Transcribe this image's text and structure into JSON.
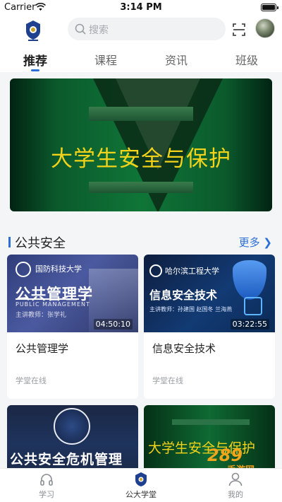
{
  "status_bar": {
    "carrier": "Carrier",
    "time": "3:14 PM"
  },
  "header": {
    "search_placeholder": "搜索",
    "logo_icon": "campus-emblem-icon",
    "scan_icon": "scan-icon"
  },
  "tabs": [
    {
      "label": "推荐",
      "active": true
    },
    {
      "label": "课程",
      "active": false
    },
    {
      "label": "资讯",
      "active": false
    },
    {
      "label": "班级",
      "active": false
    }
  ],
  "banner": {
    "title": "大学生安全与保护",
    "slide_index": 2,
    "slide_total": 2
  },
  "section": {
    "title": "公共安全",
    "more_label": "更多"
  },
  "courses": [
    {
      "title": "公共管理学",
      "source": "学堂在线",
      "duration": "04:50:10",
      "thumb_university": "国防科技大学",
      "thumb_title": "公共管理学",
      "thumb_english": "PUBLIC MANAGEMENT",
      "thumb_teacher": "主讲教师：张学礼"
    },
    {
      "title": "信息安全技术",
      "source": "学堂在线",
      "duration": "03:22:55",
      "thumb_university": "哈尔滨工程大学",
      "thumb_title": "信息安全技术",
      "thumb_teacher": "主讲教师：孙建国 赵国冬 兰海燕"
    },
    {
      "thumb_title": "公共安全危机管理"
    },
    {
      "thumb_title": "大学生安全与保护"
    }
  ],
  "watermark": {
    "logo": "289",
    "text": "手游网"
  },
  "bottom_nav": [
    {
      "label": "学习",
      "icon": "headphones-icon",
      "active": false
    },
    {
      "label": "公大学堂",
      "icon": "campus-emblem-icon",
      "active": true
    },
    {
      "label": "我的",
      "icon": "user-icon",
      "active": false
    }
  ],
  "colors": {
    "accent": "#2b6fd6",
    "banner_text": "#f2d31a"
  }
}
